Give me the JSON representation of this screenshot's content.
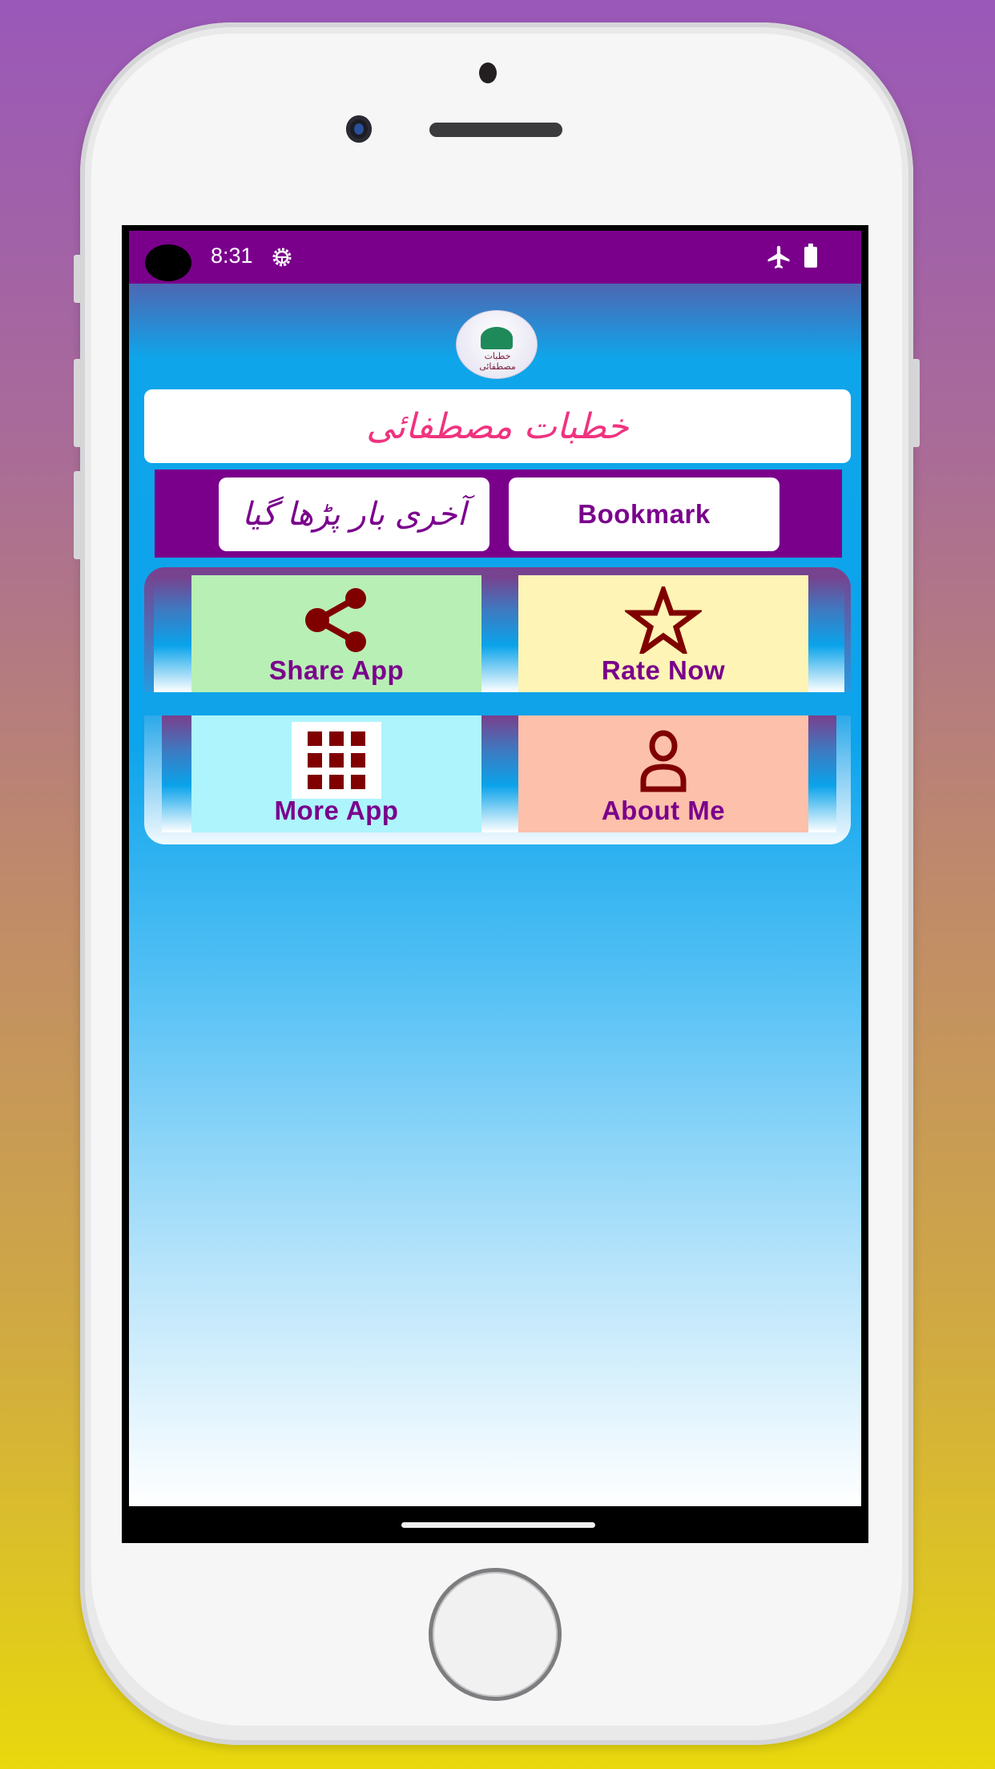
{
  "status_bar": {
    "time": "8:31",
    "icons": [
      "camera-cutout",
      "debug-gear-icon",
      "airplane-mode-icon",
      "battery-icon"
    ]
  },
  "app": {
    "title": "خطبات مصطفائی",
    "logo_caption": "خطبات مصطفائی",
    "colors": {
      "status_bar": "#7a008c",
      "title_text": "#f0337f",
      "button_text": "#7a008c",
      "icon": "#800000",
      "share_tile": "#b8efb5",
      "rate_tile": "#fdf4b5",
      "more_tile": "#aef4fc",
      "about_tile": "#fdc0ab"
    }
  },
  "actions": {
    "last_read_label": "آخری بار پڑھا گیا",
    "bookmark_label": "Bookmark"
  },
  "menu": {
    "tiles": [
      {
        "label": "Share App",
        "icon": "share-icon"
      },
      {
        "label": "Rate Now",
        "icon": "star-icon"
      },
      {
        "label": "More App",
        "icon": "apps-grid-icon"
      },
      {
        "label": "About Me",
        "icon": "person-icon"
      }
    ]
  }
}
